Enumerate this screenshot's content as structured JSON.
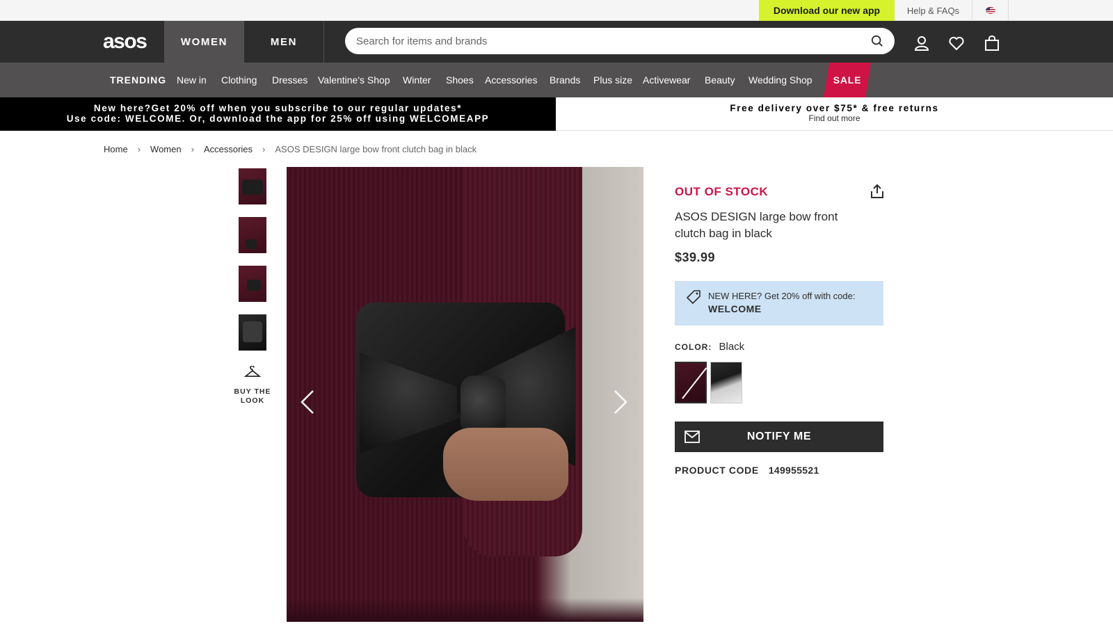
{
  "topbar": {
    "app_link": "Download our new app",
    "help": "Help & FAQs",
    "country_flag_icon": "us-flag-icon"
  },
  "header": {
    "logo": "asos",
    "gender_tabs": [
      "WOMEN",
      "MEN"
    ],
    "search": {
      "placeholder": "Search for items and brands"
    },
    "icons": [
      "account-icon",
      "saved-items-icon",
      "bag-icon"
    ]
  },
  "category_nav": [
    "TRENDING",
    "New in",
    "Clothing",
    "Dresses",
    "Valentine's Shop",
    "Winter",
    "Shoes",
    "Accessories",
    "Brands",
    "Plus size",
    "Activewear",
    "Beauty",
    "Wedding Shop",
    "SALE"
  ],
  "promos": {
    "left_line1": "New here?Get 20% off when you subscribe to our regular updates*",
    "left_line2": "Use code: WELCOME. Or, download the app for 25% off using WELCOMEAPP",
    "right_line1": "Free delivery over $75* & free returns",
    "right_line2": "Find out more"
  },
  "breadcrumb": [
    "Home",
    "Women",
    "Accessories",
    "ASOS DESIGN large bow front clutch bag in black"
  ],
  "breadcrumb_separator": "›",
  "gallery": {
    "buy_the_look_line1": "BUY THE",
    "buy_the_look_line2": "LOOK",
    "thumbnail_count": 4
  },
  "product": {
    "stock_status": "OUT OF STOCK",
    "title": "ASOS DESIGN large bow front clutch bag in black",
    "price": "$39.99",
    "promo_text": "NEW HERE? Get 20% off with code:",
    "promo_code": "WELCOME",
    "color_label": "COLOR:",
    "color_value": "Black",
    "notify_button": "NOTIFY ME",
    "product_code_label": "PRODUCT CODE",
    "product_code": "149955521"
  },
  "colors": {
    "accent_sale": "#d01345",
    "app_banner": "#d5f22d",
    "header_bg": "#2d2d2d",
    "nav_bg": "#525050",
    "promo_box": "#cde2f5"
  }
}
